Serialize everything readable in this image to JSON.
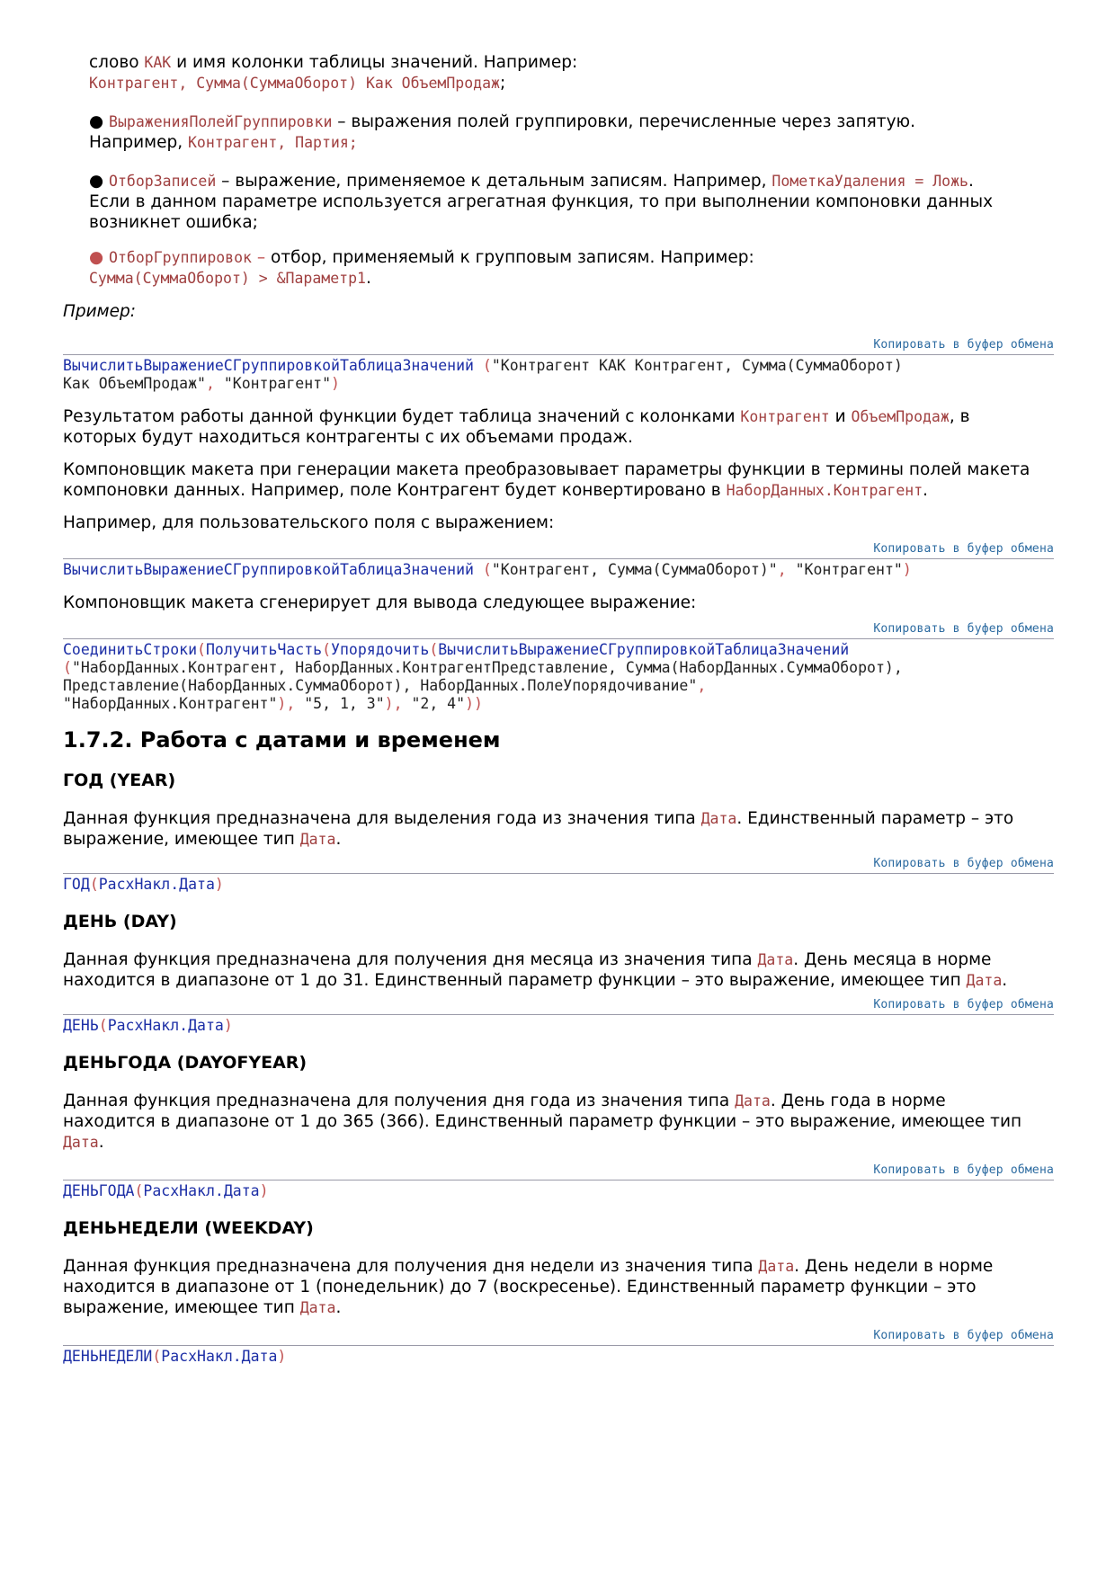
{
  "intro": {
    "line1_a": "слово ",
    "line1_kw": "КАК",
    "line1_b": " и имя колонки таблицы значений. Например:",
    "line2_code": "Контрагент, Сумма(СуммаОборот) Как ОбъемПродаж",
    "line2_tail": ";"
  },
  "bullets": [
    {
      "bullet": "●",
      "name": "ВыраженияПолейГруппировки",
      "text1": " – выражения полей группировки, перечисленные через запятую.",
      "text2": "Например, ",
      "code": "Контрагент, Партия;"
    },
    {
      "bullet": "●",
      "name": "ОтборЗаписей",
      "text1": " – выражение, применяемое к детальным записям. Например, ",
      "code1": "ПометкаУдаления = Ложь",
      "text1b": ".",
      "text2": "Если в данном параметре используется агрегатная функция, то при выполнении компоновки данных",
      "text3": "возникнет ошибка;"
    },
    {
      "bullet": "●",
      "name": "ОтборГруппировок",
      "dash": " –",
      "text1": " отбор, применяемый к групповым записям. Например:",
      "code": "Сумма(СуммаОборот) > &Параметр1",
      "tail": "."
    }
  ],
  "example_label": "Пример:",
  "copy_label": "Копировать в буфер обмена",
  "code1": {
    "fn": "ВычислитьВыражениеСГруппировкойТаблицаЗначений",
    "open": " (",
    "s1": "\"Контрагент КАК Контрагент, Сумма(СуммаОборот)",
    "s1b": "Как ОбъемПродаж\"",
    "comma": ",",
    "s2": " \"Контрагент\"",
    "close": ")"
  },
  "result_para": {
    "a": "Результатом работы данной функции будет таблица значений с колонками ",
    "k1": "Контрагент",
    "b": " и ",
    "k2": "ОбъемПродаж",
    "c": ", в",
    "d": "которых будут находиться контрагенты с их объемами продаж."
  },
  "composer_para": {
    "a": "Компоновщик макета при генерации макета преобразовывает параметры функции в термины полей макета",
    "b": "компоновки данных. Например, поле Контрагент будет конвертировано в ",
    "k": "НаборДанных.Контрагент",
    "c": "."
  },
  "custom_field_para": "Например, для пользовательского поля с выражением:",
  "code2": {
    "fn": "ВычислитьВыражениеСГруппировкойТаблицаЗначений",
    "open": " (",
    "s1": "\"Контрагент, Сумма(СуммаОборот)\"",
    "comma": ",",
    "s2": " \"Контрагент\"",
    "close": ")"
  },
  "generate_para": "Компоновщик макета сгенерирует для вывода следующее выражение:",
  "code3": {
    "f1": "СоединитьСтроки",
    "p1": "(",
    "f2": "ПолучитьЧасть",
    "p2": "(",
    "f3": "Упорядочить",
    "p3": "(",
    "f4": "ВычислитьВыражениеСГруппировкойТаблицаЗначений",
    "p4": "(",
    "l2": "\"НаборДанных.Контрагент, НаборДанных.КонтрагентПредставление, Сумма(НаборДанных.СуммаОборот),",
    "l3a": "Представление(НаборДанных.СуммаОборот), НаборДанных.ПолеУпорядочивание\"",
    "l3b": ",",
    "l4a": "\"НаборДанных.Контрагент\"",
    "l4b": "),",
    "l4c": " \"5, 1, 3\"",
    "l4d": "),",
    "l4e": " \"2, 4\"",
    "l4f": "))"
  },
  "section_title": "1.7.2. Работа с датами и временем",
  "functions": [
    {
      "heading": "ГОД (YEAR)",
      "desc1a": "Данная функция предназначена для выделения года из значения типа ",
      "desc1k": "Дата",
      "desc1b": ". Единственный параметр – это",
      "desc2a": "выражение, имеющее тип ",
      "desc2k": "Дата",
      "desc2b": ".",
      "code_fn": "ГОД",
      "code_open": "(",
      "code_arg": "РасхНакл.Дата",
      "code_close": ")"
    },
    {
      "heading": "ДЕНЬ (DAY)",
      "desc1a": "Данная функция предназначена для получения дня месяца из значения типа ",
      "desc1k": "Дата",
      "desc1b": ". День месяца в норме",
      "desc2a": "находится в диапазоне от 1 до 31. Единственный параметр функции – это выражение, имеющее тип ",
      "desc2k": "Дата",
      "desc2b": ".",
      "code_fn": "ДЕНЬ",
      "code_open": "(",
      "code_arg": "РасхНакл.Дата",
      "code_close": ")"
    },
    {
      "heading": "ДЕНЬГОДА (DAYOFYEAR)",
      "desc1a": "Данная функция предназначена для получения дня года из значения типа ",
      "desc1k": "Дата",
      "desc1b": ". День года в норме",
      "desc2a": "находится в диапазоне от 1 до 365 (366). Единственный параметр функции – это выражение, имеющее тип",
      "desc3k": "Дата",
      "desc3b": ".",
      "code_fn": "ДЕНЬГОДА",
      "code_open": "(",
      "code_arg": "РасхНакл.Дата",
      "code_close": ")"
    },
    {
      "heading": "ДЕНЬНЕДЕЛИ (WEEKDAY)",
      "desc1a": "Данная функция предназначена для получения дня недели из значения типа ",
      "desc1k": "Дата",
      "desc1b": ". День недели в норме",
      "desc2a": "находится в диапазоне от 1 (понедельник) до 7 (воскресенье). Единственный параметр функции – это",
      "desc3a": "выражение, имеющее тип ",
      "desc3k": "Дата",
      "desc3b": ".",
      "code_fn": "ДЕНЬНЕДЕЛИ",
      "code_open": "(",
      "code_arg": "РасхНакл.Дата",
      "code_close": ")"
    }
  ]
}
